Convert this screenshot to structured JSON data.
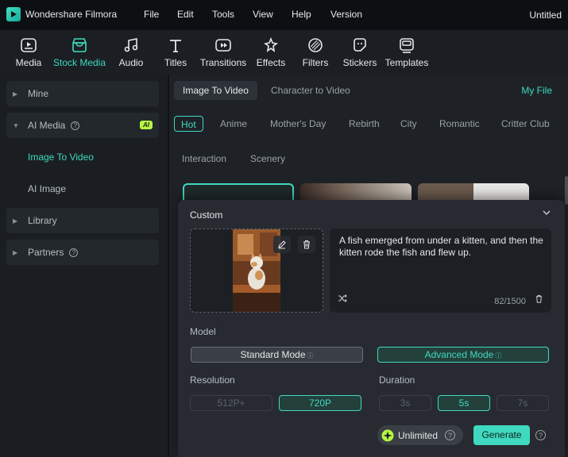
{
  "app": {
    "name": "Wondershare Filmora",
    "doc_title": "Untitled"
  },
  "menu": [
    "File",
    "Edit",
    "Tools",
    "View",
    "Help",
    "Version"
  ],
  "toolbar": [
    {
      "label": "Media",
      "icon": "media-icon"
    },
    {
      "label": "Stock Media",
      "icon": "stock-media-icon",
      "active": true
    },
    {
      "label": "Audio",
      "icon": "audio-icon"
    },
    {
      "label": "Titles",
      "icon": "titles-icon"
    },
    {
      "label": "Transitions",
      "icon": "transitions-icon"
    },
    {
      "label": "Effects",
      "icon": "effects-icon"
    },
    {
      "label": "Filters",
      "icon": "filters-icon"
    },
    {
      "label": "Stickers",
      "icon": "stickers-icon"
    },
    {
      "label": "Templates",
      "icon": "templates-icon"
    }
  ],
  "sidebar": {
    "mine": "Mine",
    "ai_media": "AI Media",
    "ai_badge": "AI",
    "image_to_video": "Image To Video",
    "ai_image": "AI Image",
    "library": "Library",
    "partners": "Partners"
  },
  "main": {
    "tabs": [
      "Image To Video",
      "Character to Video"
    ],
    "my_file": "My File",
    "categories_row1": [
      "Hot",
      "Anime",
      "Mother's Day",
      "Rebirth",
      "City",
      "Romantic",
      "Critter Club"
    ],
    "categories_row2": [
      "Interaction",
      "Scenery"
    ]
  },
  "custom": {
    "title": "Custom",
    "prompt": "A fish emerged from under a kitten, and then the kitten rode the fish and flew up.",
    "counter": "82/1500",
    "model_label": "Model",
    "standard_mode": "Standard Mode",
    "advanced_mode": "Advanced Mode",
    "resolution_label": "Resolution",
    "res_512": "512P+",
    "res_720": "720P",
    "duration_label": "Duration",
    "dur_3": "3s",
    "dur_5": "5s",
    "dur_7": "7s",
    "unlimited": "Unlimited",
    "generate": "Generate"
  },
  "colors": {
    "accent": "#3fd9bf",
    "ai_badge": "#b6f442",
    "bg": "#1e2227"
  }
}
